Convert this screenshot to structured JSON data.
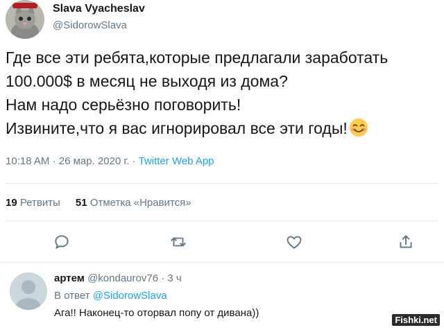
{
  "author": {
    "name": "Slava Vyacheslav",
    "handle": "@SidorowSlava"
  },
  "tweet": {
    "lines": [
      "Где все эти ребята,которые предлагали заработать",
      "100.000$ в месяц не выходя из дома?",
      "Нам надо серьёзно поговорить!",
      "Извините,что я вас игнорировал все эти годы!"
    ],
    "emoji": "smiling-face-emoji",
    "time": "10:18 AM",
    "date": "26 мар. 2020 г.",
    "separator": "·",
    "source": "Twitter Web App"
  },
  "stats": {
    "retweets_count": "19",
    "retweets_label": "Ретвиты",
    "likes_count": "51",
    "likes_label": "Отметка «Нравится»"
  },
  "actions": [
    "reply-icon",
    "retweet-icon",
    "like-icon",
    "share-icon"
  ],
  "reply": {
    "name": "артем",
    "handle": "@kondaurov76",
    "separator": "·",
    "time": "3 ч",
    "reply_to_prefix": "В ответ",
    "reply_to_handle": "@SidorowSlava",
    "text": "Ага!! Наконец-то оторвал попу от дивана))"
  },
  "watermark": "Fishki.net",
  "colors": {
    "link": "#1da1f2",
    "secondary": "#657786",
    "primary_text": "#14171a",
    "divider": "#e6ecf0"
  }
}
